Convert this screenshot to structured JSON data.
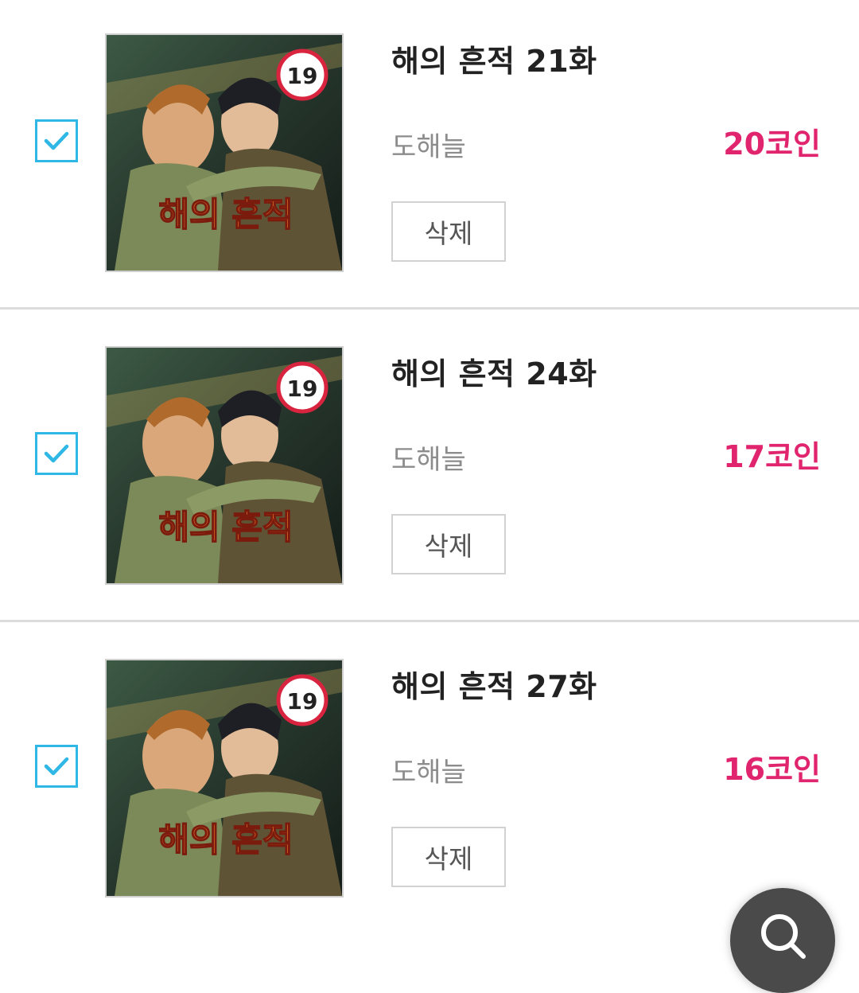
{
  "items": [
    {
      "title": "해의 흔적 21화",
      "author": "도해늘",
      "price": "20코인",
      "delete_label": "삭제",
      "checked": true,
      "age_badge": "19",
      "cover_title": "해의 흔적"
    },
    {
      "title": "해의 흔적 24화",
      "author": "도해늘",
      "price": "17코인",
      "delete_label": "삭제",
      "checked": true,
      "age_badge": "19",
      "cover_title": "해의 흔적"
    },
    {
      "title": "해의 흔적 27화",
      "author": "도해늘",
      "price": "16코인",
      "delete_label": "삭제",
      "checked": true,
      "age_badge": "19",
      "cover_title": "해의 흔적"
    }
  ],
  "colors": {
    "accent": "#2fb7e6",
    "price": "#e0246e",
    "divider": "#dcdcdc"
  },
  "fab": {
    "icon": "search-icon"
  }
}
